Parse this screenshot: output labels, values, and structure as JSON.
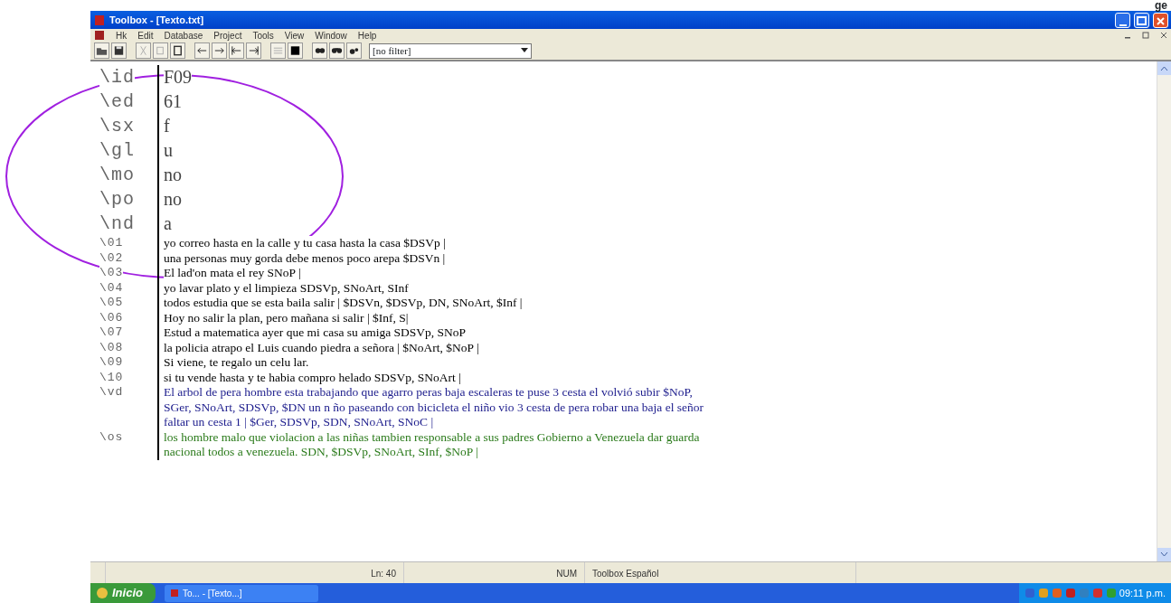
{
  "page_fragment": "ge",
  "window": {
    "title": "Toolbox - [Texto.txt]"
  },
  "menu": [
    "Hk",
    "Edit",
    "Database",
    "Project",
    "Tools",
    "View",
    "Window",
    "Help"
  ],
  "toolbar": {
    "filter": "[no filter]"
  },
  "records": [
    {
      "kind": "header",
      "marker": "\\id",
      "lines": [
        "F09"
      ]
    },
    {
      "kind": "header",
      "marker": "\\ed",
      "lines": [
        "61"
      ]
    },
    {
      "kind": "header",
      "marker": "\\sx",
      "lines": [
        "f"
      ]
    },
    {
      "kind": "header",
      "marker": "\\gl",
      "lines": [
        "u"
      ]
    },
    {
      "kind": "header",
      "marker": "\\mo",
      "lines": [
        "no"
      ]
    },
    {
      "kind": "header",
      "marker": "\\po",
      "lines": [
        "no"
      ]
    },
    {
      "kind": "header",
      "marker": "\\nd",
      "lines": [
        "a"
      ]
    },
    {
      "kind": "line",
      "marker": "\\01",
      "color": "#000000",
      "lines": [
        "yo correo hasta en la calle y tu casa hasta la casa  $DSVp |"
      ]
    },
    {
      "kind": "line",
      "marker": "\\02",
      "color": "#000000",
      "lines": [
        "una personas muy gorda debe menos poco arepa  $DSVn |"
      ]
    },
    {
      "kind": "line",
      "marker": "\\03",
      "color": "#000000",
      "lines": [
        "El lad'on mata el rey  SNoP |"
      ]
    },
    {
      "kind": "line",
      "marker": "\\04",
      "color": "#000000",
      "lines": [
        "yo lavar plato y el limpieza  SDSVp, SNoArt, SInf"
      ]
    },
    {
      "kind": "line",
      "marker": "\\05",
      "color": "#000000",
      "lines": [
        "todos estudia que se esta baila salir | $DSVn, $DSVp, DN, SNoArt, $Inf |"
      ]
    },
    {
      "kind": "line",
      "marker": "\\06",
      "color": "#000000",
      "lines": [
        "Hoy no salir la plan, pero mañana si salir | $Inf, S|"
      ]
    },
    {
      "kind": "line",
      "marker": "\\07",
      "color": "#000000",
      "lines": [
        "Estud a matematica ayer que mi casa su amiga  SDSVp, SNoP"
      ]
    },
    {
      "kind": "line",
      "marker": "\\08",
      "color": "#000000",
      "lines": [
        "la policia atrapo el Luis cuando piedra a señora | $NoArt, $NoP |"
      ]
    },
    {
      "kind": "line",
      "marker": "\\09",
      "color": "#000000",
      "lines": [
        "Si viene, te regalo un celu lar."
      ]
    },
    {
      "kind": "line",
      "marker": "\\10",
      "color": "#000000",
      "lines": [
        "si tu vende hasta y te habia compro helado  SDSVp, SNoArt |"
      ]
    },
    {
      "kind": "line",
      "marker": "\\vd",
      "color": "#1c1c8c",
      "lines": [
        "El arbol de pera hombre esta trabajando que agarro peras baja escaleras te puse 3 cesta el volvió subir  $NoP,",
        "SGer, SNoArt, SDSVp, $DN  un n ño paseando con bicicleta el niño vio 3 cesta de pera robar una baja  el señor",
        "faltar un cesta 1 | $Ger, SDSVp, SDN, SNoArt, SNoC |"
      ]
    },
    {
      "kind": "line",
      "marker": "\\os",
      "color": "#2a7a1a",
      "lines": [
        "los hombre malo que violacion a las niñas tambien responsable a sus padres Gobierno a Venezuela dar guarda",
        "nacional todos a venezuela.  SDN, $DSVp, SNoArt, SInf, $NoP |"
      ]
    }
  ],
  "status_bar": [
    "Ln: 40",
    "NUM",
    "Toolbox Español"
  ],
  "taskbar": {
    "start": "Inicio",
    "task": "To... - [Texto...]",
    "clock": "09:11 p.m."
  }
}
